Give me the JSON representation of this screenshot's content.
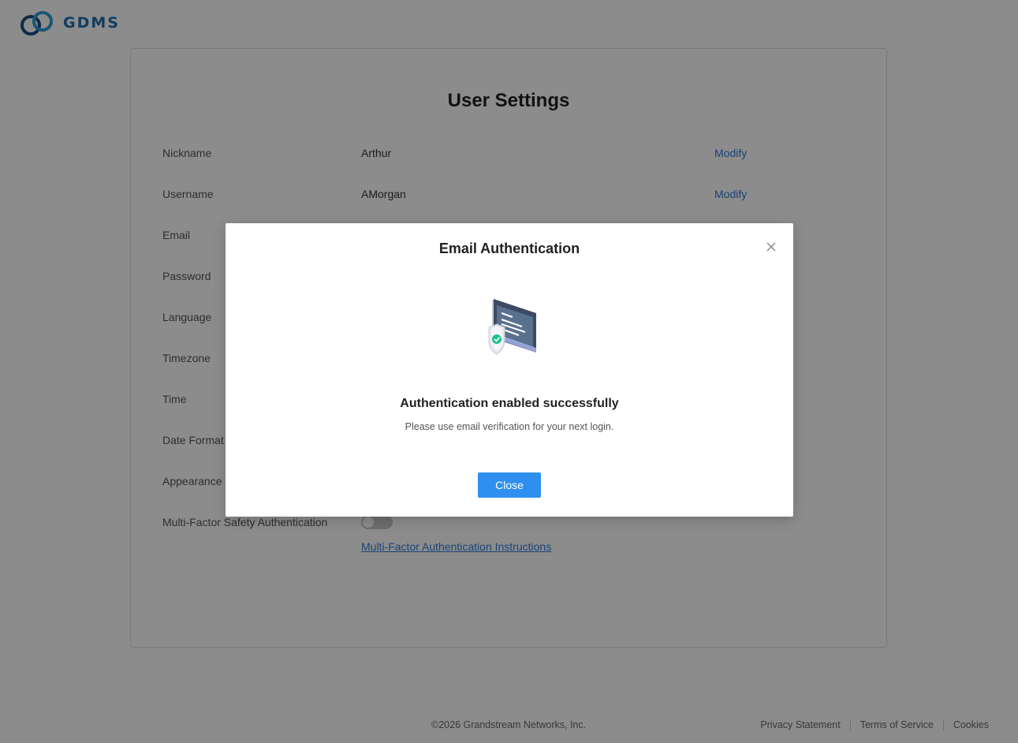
{
  "brand": {
    "name": "GDMS"
  },
  "settings": {
    "title": "User Settings",
    "rows": [
      {
        "label": "Nickname",
        "value": "Arthur",
        "action": "Modify"
      },
      {
        "label": "Username",
        "value": "AMorgan",
        "action": "Modify"
      },
      {
        "label": "Email"
      },
      {
        "label": "Password"
      },
      {
        "label": "Language"
      },
      {
        "label": "Timezone"
      },
      {
        "label": "Time"
      },
      {
        "label": "Date Format"
      },
      {
        "label": "Appearance"
      },
      {
        "label": "Multi-Factor Safety Authentication"
      }
    ],
    "mfa_toggle_on": false,
    "mfa_link": "Multi-Factor Authentication Instructions"
  },
  "footer": {
    "copyright": "©2026 Grandstream Networks, Inc.",
    "links": [
      "Privacy Statement",
      "Terms of Service",
      "Cookies"
    ]
  },
  "modal": {
    "title": "Email Authentication",
    "message_title": "Authentication enabled successfully",
    "message_body": "Please use email verification for your next login.",
    "close_label": "Close"
  },
  "colors": {
    "accent": "#2f8ff0",
    "link": "#2f7bd9",
    "brand": "#1f6fb0"
  }
}
